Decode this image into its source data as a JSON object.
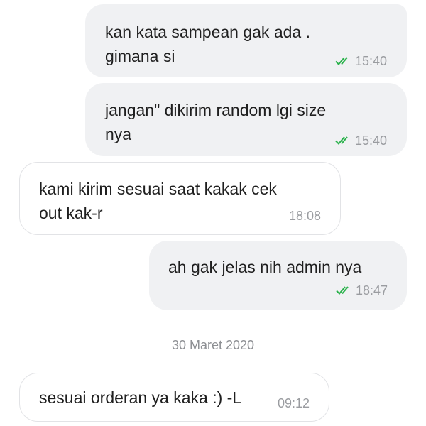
{
  "messages": [
    {
      "direction": "outgoing",
      "text": "kan kata sampean gak ada .\ngimana si",
      "time": "15:40",
      "read_check": "double-check-icon"
    },
    {
      "direction": "outgoing",
      "text": "jangan\" dikirim random lgi size\nnya",
      "time": "15:40",
      "read_check": "double-check-icon"
    },
    {
      "direction": "incoming",
      "text": "kami kirim sesuai saat kakak cek\nout kak-r",
      "time": "18:08"
    },
    {
      "direction": "outgoing",
      "text": "ah gak jelas nih admin nya",
      "time": "18:47",
      "read_check": "double-check-icon"
    },
    {
      "direction": "incoming",
      "text": "sesuai orderan ya kaka :) -L",
      "time": "09:12"
    }
  ],
  "date_separator": "30 Maret 2020",
  "colors": {
    "outgoing_bubble": "#f0f1f3",
    "incoming_border": "#e2e3e6",
    "check_green": "#2bb24c",
    "time_gray": "#9a9ca0"
  }
}
